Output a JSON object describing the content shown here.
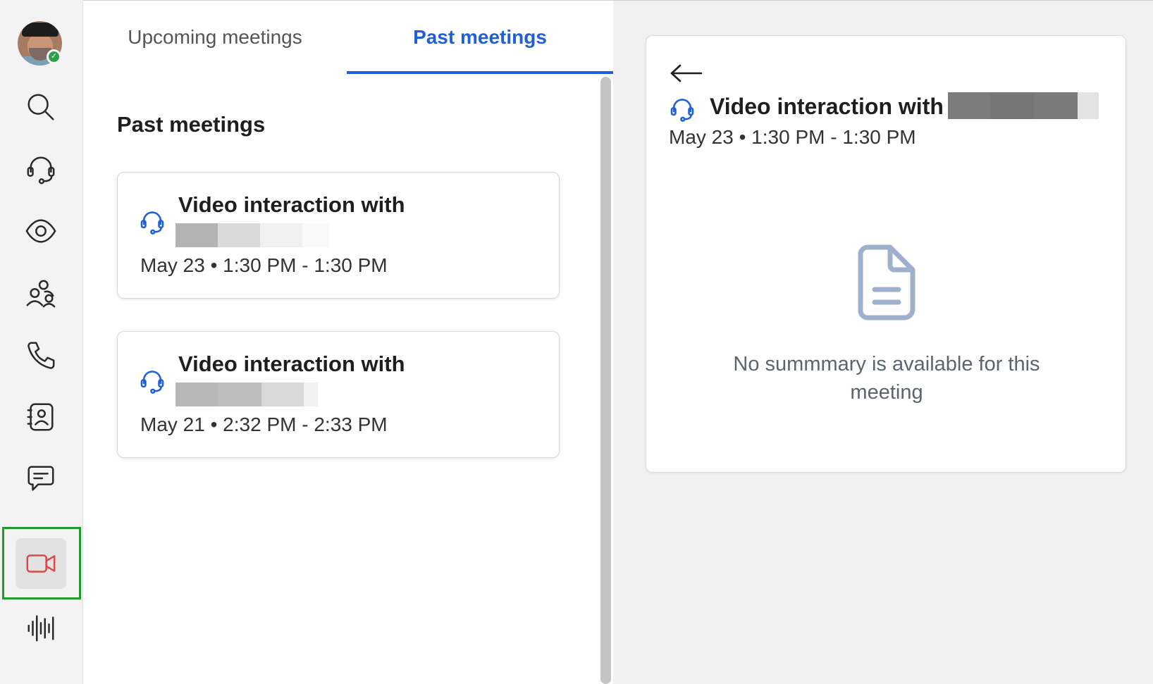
{
  "rail": {
    "items": [
      {
        "name": "search",
        "icon": "search-icon"
      },
      {
        "name": "contact-center",
        "icon": "headset-icon"
      },
      {
        "name": "monitor",
        "icon": "eye-icon"
      },
      {
        "name": "teams",
        "icon": "people-icon"
      },
      {
        "name": "calls",
        "icon": "phone-icon"
      },
      {
        "name": "contacts",
        "icon": "contact-book-icon"
      },
      {
        "name": "messages",
        "icon": "chat-icon"
      },
      {
        "name": "meetings",
        "icon": "video-camera-icon",
        "active": true
      },
      {
        "name": "voice",
        "icon": "waveform-icon"
      }
    ],
    "active_color": "#d84a4a",
    "presence": "available"
  },
  "tabs": {
    "upcoming_label": "Upcoming meetings",
    "past_label": "Past meetings",
    "selected": "past"
  },
  "list": {
    "section_title": "Past meetings",
    "meetings": [
      {
        "title": "Video interaction with",
        "time": "May 23 • 1:30 PM - 1:30 PM",
        "icon": "headset-icon"
      },
      {
        "title": "Video interaction with",
        "time": "May 21 • 2:32 PM - 2:33 PM",
        "icon": "headset-icon"
      }
    ]
  },
  "detail": {
    "title": "Video interaction with",
    "time": "May 23 • 1:30 PM - 1:30 PM",
    "empty_message": "No summmary is available for this meeting",
    "icon": "headset-icon",
    "empty_icon": "document-icon"
  },
  "colors": {
    "accent": "#1f5fd8",
    "focus_outline": "#1f9a2b",
    "empty_icon": "#9fb0cc"
  }
}
